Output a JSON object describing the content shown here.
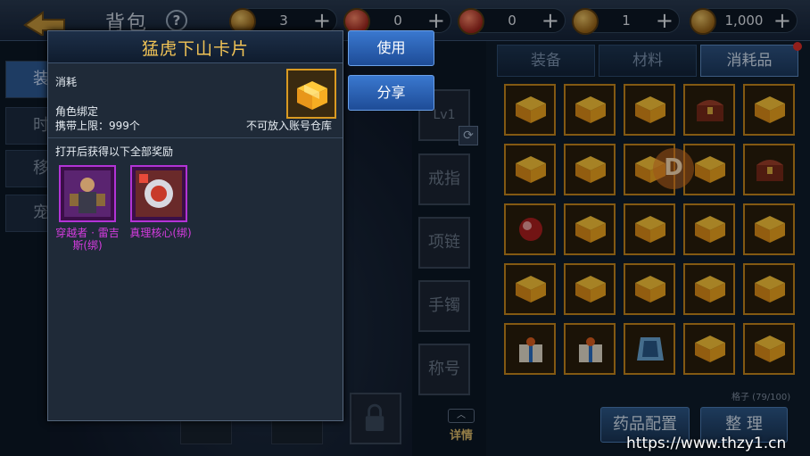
{
  "topbar": {
    "title": "背包",
    "help": "?",
    "currencies": [
      {
        "icon": "gold-medal-icon",
        "value": "3"
      },
      {
        "icon": "red-ticket-icon",
        "value": "0"
      },
      {
        "icon": "red-scroll-icon",
        "value": "0"
      },
      {
        "icon": "gold-coin-icon",
        "value": "1"
      },
      {
        "icon": "gold-stack-icon",
        "value": "1,000"
      }
    ],
    "plus": "+"
  },
  "left_tabs": [
    "装",
    "时",
    "移",
    "宠"
  ],
  "equip_slots": {
    "weapon_level": "Lv1",
    "slots": [
      "戒指",
      "项链",
      "手镯",
      "称号"
    ],
    "detail_label": "详情",
    "detail_arrow": "︿"
  },
  "inventory": {
    "tabs": [
      "装备",
      "材料",
      "消耗品"
    ],
    "active_tab": "消耗品",
    "capacity": "格子 (79/100)",
    "buttons": {
      "potion": "药品配置",
      "sort": "整 理"
    },
    "badge": "D",
    "accent": "#c9891c"
  },
  "popup": {
    "title": "猛虎下山卡片",
    "type": "消耗",
    "bind": "角色绑定",
    "limit": "携带上限：999个",
    "storage_note": "不可放入账号仓库",
    "reward_header": "打开后获得以下全部奖励",
    "rewards": [
      {
        "name": "穿越者 · 雷吉斯(绑)",
        "line1": "穿越者 · 雷吉",
        "line2": "斯(绑)"
      },
      {
        "name": "真理核心(绑)",
        "line1": "真理核心(绑)",
        "line2": ""
      }
    ],
    "title_color": "#f2c456",
    "reward_color": "#d63ce0"
  },
  "actions": {
    "use": "使用",
    "share": "分享"
  },
  "watermark": "https://www.thzy1.cn"
}
